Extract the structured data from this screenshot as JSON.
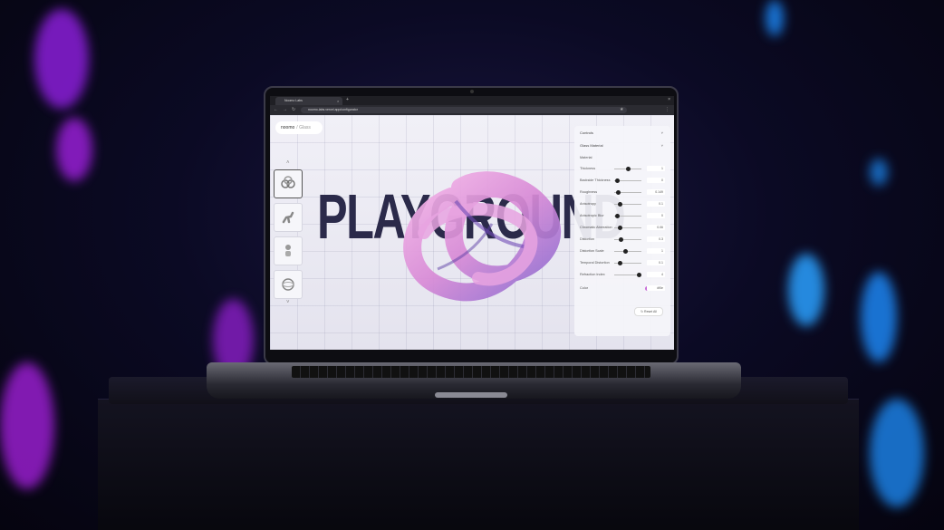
{
  "browser": {
    "tab_title": "Noomo Labs",
    "tab_close": "×",
    "new_tab": "+",
    "window_close": "×",
    "url": "noomo-labs.vercel.app/configurator",
    "back": "←",
    "forward": "→",
    "reload": "↻",
    "bookmark": "★",
    "menu": "⋮"
  },
  "app": {
    "logo": "noomo",
    "logo_sub": "/ Glass",
    "headline": "PLAYGROUND",
    "chevron_up": "˄",
    "chevron_down": "˅"
  },
  "panel": {
    "section_1": "Controls",
    "section_2": "Glass Material",
    "sub_section": "Material",
    "rows": [
      {
        "label": "Thickness",
        "value": "1",
        "level": 0.5
      },
      {
        "label": "Backside Thickness",
        "value": "0",
        "level": 0.1
      },
      {
        "label": "Roughness",
        "value": "0.149",
        "level": 0.15
      },
      {
        "label": "Anisotropy",
        "value": "0.1",
        "level": 0.2
      },
      {
        "label": "Anisotropic Blur",
        "value": "0",
        "level": 0.1
      },
      {
        "label": "Chromatic Aberration",
        "value": "0.06",
        "level": 0.2
      },
      {
        "label": "Distortion",
        "value": "0.3",
        "level": 0.25
      },
      {
        "label": "Distortion Scale",
        "value": "1",
        "level": 0.4
      },
      {
        "label": "Temporal Distortion",
        "value": "0.1",
        "level": 0.2
      },
      {
        "label": "Refraction Index",
        "value": "4",
        "level": 0.9
      }
    ],
    "color_label": "Color",
    "color_value": "#f0e",
    "reset_label": "↻ Reset All"
  }
}
